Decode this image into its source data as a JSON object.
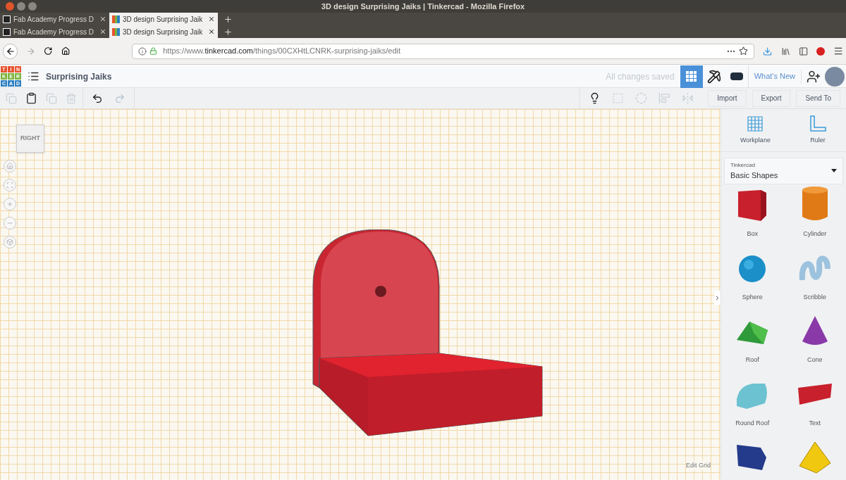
{
  "window": {
    "title": "3D design Surprising Jaiks | Tinkercad - Mozilla Firefox"
  },
  "tab_rows": [
    [
      {
        "label": "Fab Academy Progress D",
        "selected": false
      },
      {
        "label": "3D design Surprising Jaik",
        "selected": true
      }
    ],
    [
      {
        "label": "Fab Academy Progress D",
        "selected": false
      },
      {
        "label": "3D design Surprising Jaik",
        "selected": true
      }
    ]
  ],
  "address_bar": {
    "prefix": "https://www.",
    "domain": "tinkercad.com",
    "path": "/things/00CXHtLCNRK-surprising-jaiks/edit"
  },
  "app_header": {
    "logo_letters": [
      "T",
      "I",
      "N",
      "K",
      "E",
      "R",
      "C",
      "A",
      "D"
    ],
    "design_name": "Surprising Jaiks",
    "save_status": "All changes saved",
    "whats_new": "What's New"
  },
  "toolbar": {
    "buttons": [
      "Import",
      "Export",
      "Send To"
    ]
  },
  "view_cube": {
    "label": "RIGHT"
  },
  "panel": {
    "tools": [
      {
        "label": "Workplane",
        "kind": "workplane"
      },
      {
        "label": "Ruler",
        "kind": "ruler"
      }
    ],
    "library": {
      "caption": "Tinkercad",
      "value": "Basic Shapes"
    },
    "shapes": [
      {
        "label": "Box",
        "kind": "box"
      },
      {
        "label": "Cylinder",
        "kind": "cylinder"
      },
      {
        "label": "Sphere",
        "kind": "sphere"
      },
      {
        "label": "Scribble",
        "kind": "scribble"
      },
      {
        "label": "Roof",
        "kind": "roof"
      },
      {
        "label": "Cone",
        "kind": "cone"
      },
      {
        "label": "Round Roof",
        "kind": "roundroof"
      },
      {
        "label": "Text",
        "kind": "text"
      },
      {
        "kind": "wedge"
      },
      {
        "kind": "pyramid"
      }
    ]
  },
  "grid_control": {
    "label": "Edit Grid"
  }
}
